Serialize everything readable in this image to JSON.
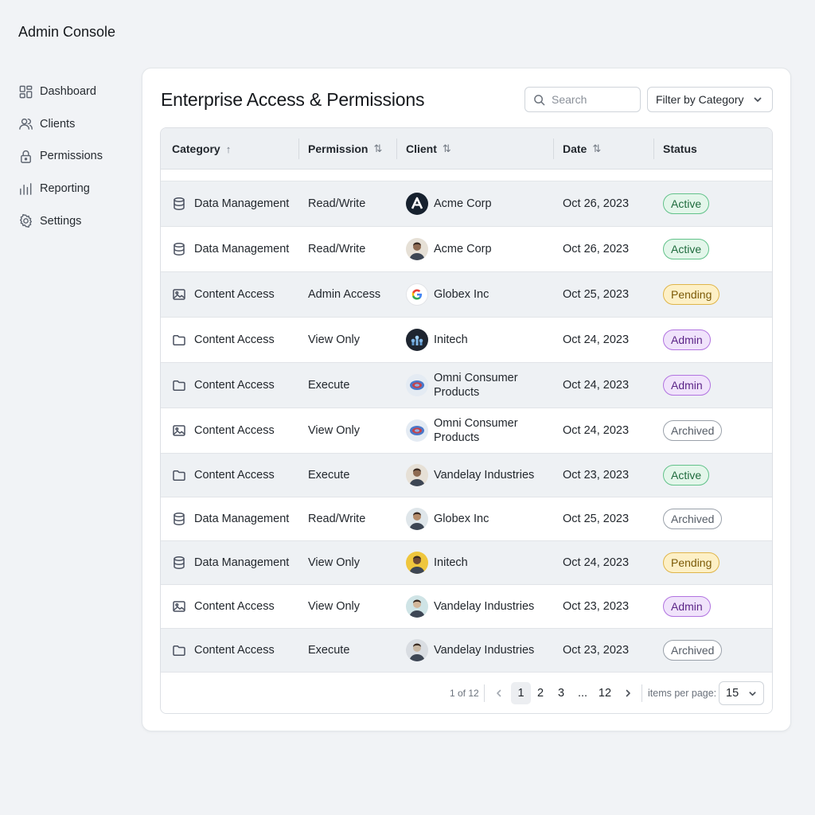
{
  "app": {
    "title": "Admin Console"
  },
  "sidebar": {
    "items": [
      {
        "label": "Dashboard",
        "icon": "dashboard-icon"
      },
      {
        "label": "Clients",
        "icon": "users-icon"
      },
      {
        "label": "Permissions",
        "icon": "lock-icon"
      },
      {
        "label": "Reporting",
        "icon": "bar-chart-icon"
      },
      {
        "label": "Settings",
        "icon": "gear-icon"
      }
    ]
  },
  "main": {
    "title": "Enterprise Access & Permissions",
    "search": {
      "placeholder": "Search",
      "value": ""
    },
    "filter": {
      "label": "Filter by Category"
    }
  },
  "table": {
    "columns": [
      {
        "label": "Category",
        "sort": "↑"
      },
      {
        "label": "Permission",
        "sort": "⇅"
      },
      {
        "label": "Client",
        "sort": "⇅"
      },
      {
        "label": "Date",
        "sort": "⇅"
      },
      {
        "label": "Status",
        "sort": ""
      }
    ],
    "rows": [
      {
        "category": "Data Management",
        "category_icon": "database-icon",
        "permission": "Read/Write",
        "client": "Acme Corp",
        "client_logo": "acme-logo",
        "date": "Oct 26, 2023",
        "status": "Active"
      },
      {
        "category": "Data Management",
        "category_icon": "database-icon",
        "permission": "Read/Write",
        "client": "Acme Corp",
        "client_logo": "person-avatar",
        "date": "Oct 26, 2023",
        "status": "Active"
      },
      {
        "category": "Content Access",
        "category_icon": "image-icon",
        "permission": "Admin Access",
        "client": "Globex Inc",
        "client_logo": "google-logo",
        "date": "Oct 25, 2023",
        "status": "Pending"
      },
      {
        "category": "Content Access",
        "category_icon": "folder-icon",
        "permission": "View Only",
        "client": "Initech",
        "client_logo": "initech-logo",
        "date": "Oct 24, 2023",
        "status": "Admin"
      },
      {
        "category": "Content Access",
        "category_icon": "folder-icon",
        "permission": "Execute",
        "client": "Omni Consumer Products",
        "client_logo": "omni-logo",
        "date": "Oct 24, 2023",
        "status": "Admin"
      },
      {
        "category": "Content Access",
        "category_icon": "image-icon",
        "permission": "View Only",
        "client": "Omni Consumer Products",
        "client_logo": "omni-logo",
        "date": "Oct 24, 2023",
        "status": "Archived"
      },
      {
        "category": "Content Access",
        "category_icon": "folder-icon",
        "permission": "Execute",
        "client": "Vandelay Industries",
        "client_logo": "person-avatar",
        "date": "Oct 23, 2023",
        "status": "Active"
      },
      {
        "category": "Data Management",
        "category_icon": "database-icon",
        "permission": "Read/Write",
        "client": "Globex Inc",
        "client_logo": "person-avatar",
        "date": "Oct 25, 2023",
        "status": "Archived"
      },
      {
        "category": "Data Management",
        "category_icon": "database-icon",
        "permission": "View Only",
        "client": "Initech",
        "client_logo": "person-avatar",
        "date": "Oct 24, 2023",
        "status": "Pending"
      },
      {
        "category": "Content Access",
        "category_icon": "image-icon",
        "permission": "View Only",
        "client": "Vandelay Industries",
        "client_logo": "person-avatar",
        "date": "Oct 23, 2023",
        "status": "Admin"
      },
      {
        "category": "Content Access",
        "category_icon": "folder-icon",
        "permission": "Execute",
        "client": "Vandelay Industries",
        "client_logo": "person-avatar",
        "date": "Oct 23, 2023",
        "status": "Archived"
      }
    ]
  },
  "pagination": {
    "info": "1 of 12",
    "pages": [
      "1",
      "2",
      "3",
      "...",
      "12"
    ],
    "current": "1",
    "items_per_page_label": "items per page:",
    "items_per_page": "15"
  },
  "colors": {
    "active": "#62c28a",
    "pending": "#dfb54a",
    "admin": "#b173e0",
    "archived": "#9aa1aa"
  }
}
